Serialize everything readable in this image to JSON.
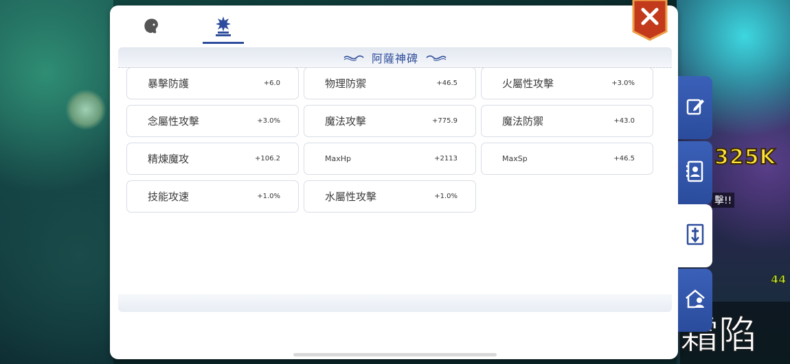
{
  "background": {
    "damage_number": "325K",
    "combat_text": "擊!!",
    "side_number": "44",
    "big_text": "霜陷"
  },
  "tabs": [
    {
      "icon": "character-head-icon",
      "active": false
    },
    {
      "icon": "monument-icon",
      "active": true
    }
  ],
  "panel": {
    "title": "阿薩神碑",
    "accent_color": "#2d4c9b"
  },
  "stats": [
    {
      "label": "暴擊防護",
      "value": "+6.0"
    },
    {
      "label": "物理防禦",
      "value": "+46.5"
    },
    {
      "label": "火屬性攻擊",
      "value": "+3.0%"
    },
    {
      "label": "念屬性攻擊",
      "value": "+3.0%"
    },
    {
      "label": "魔法攻擊",
      "value": "+775.9"
    },
    {
      "label": "魔法防禦",
      "value": "+43.0"
    },
    {
      "label": "精煉魔攻",
      "value": "+106.2"
    },
    {
      "label": "MaxHp",
      "value": "+2113"
    },
    {
      "label": "MaxSp",
      "value": "+46.5"
    },
    {
      "label": "技能攻速",
      "value": "+1.0%"
    },
    {
      "label": "水屬性攻擊",
      "value": "+1.0%"
    }
  ],
  "side_nav": [
    {
      "icon": "edit-icon",
      "active": false
    },
    {
      "icon": "contact-book-icon",
      "active": false
    },
    {
      "icon": "monument-icon",
      "active": true
    },
    {
      "icon": "guild-house-icon",
      "active": false
    }
  ]
}
